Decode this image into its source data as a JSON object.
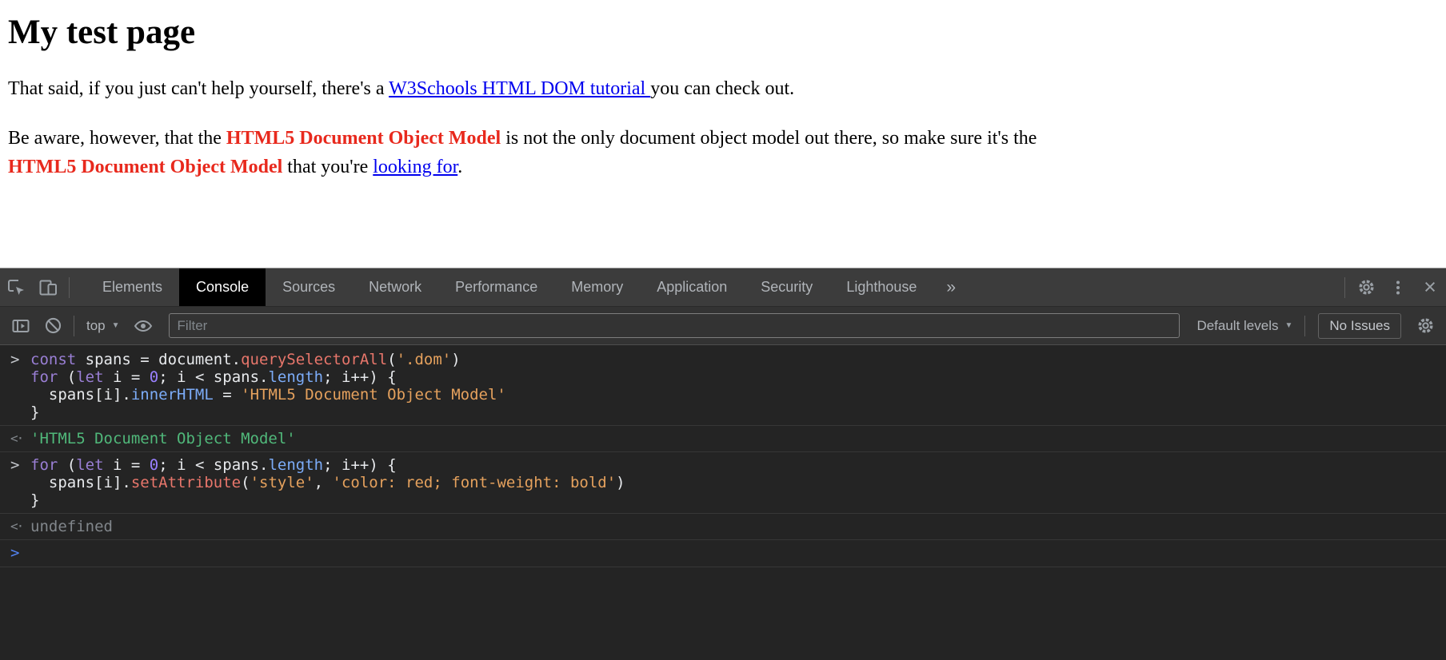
{
  "page": {
    "title": "My test page",
    "para1": {
      "text_before": "That said, if you just can't help yourself, there's a ",
      "link_text": "W3Schools HTML DOM tutorial ",
      "text_after": "you can check out."
    },
    "para2": {
      "text1": "Be aware, however, that the ",
      "highlight1": "HTML5 Document Object Model",
      "text2": " is not the only document object model out there, so make sure it's the",
      "highlight2": "HTML5 Document Object Model",
      "text3": " that you're ",
      "link_text": "looking for",
      "text4": "."
    }
  },
  "colors": {
    "link_blue": "#0000ee",
    "highlight_red": "#e8291d",
    "console_background": "#242424",
    "toolbar_background": "#333333",
    "tabbar_background": "#3c3c3c",
    "active_tab_background": "#000000",
    "result_string_green": "#50b87a",
    "string_orange": "#e5a15d",
    "keyword_purple": "#9a7fd5",
    "function_salmon": "#e8766b",
    "property_blue": "#7cacf8",
    "prompt_blue": "#5282f0"
  },
  "devtools": {
    "tab_bar": {
      "tabs": [
        {
          "label": "Elements",
          "active": false
        },
        {
          "label": "Console",
          "active": true
        },
        {
          "label": "Sources",
          "active": false
        },
        {
          "label": "Network",
          "active": false
        },
        {
          "label": "Performance",
          "active": false
        },
        {
          "label": "Memory",
          "active": false
        },
        {
          "label": "Application",
          "active": false
        },
        {
          "label": "Security",
          "active": false
        },
        {
          "label": "Lighthouse",
          "active": false
        }
      ],
      "more_tabs": "»"
    },
    "toolbar": {
      "context_selector": "top",
      "filter_placeholder": "Filter",
      "levels_label": "Default levels",
      "issues_label": "No Issues"
    },
    "console": {
      "entries": [
        {
          "type": "input",
          "lines": [
            [
              {
                "t": "const",
                "c": "kw"
              },
              {
                "t": " spans = document.",
                "c": "pl"
              },
              {
                "t": "querySelectorAll",
                "c": "fn"
              },
              {
                "t": "(",
                "c": "pl"
              },
              {
                "t": "'.dom'",
                "c": "str"
              },
              {
                "t": ")",
                "c": "pl"
              }
            ],
            [
              {
                "t": "for",
                "c": "kw"
              },
              {
                "t": " (",
                "c": "pl"
              },
              {
                "t": "let",
                "c": "kw"
              },
              {
                "t": " i = ",
                "c": "pl"
              },
              {
                "t": "0",
                "c": "num"
              },
              {
                "t": "; i < spans.",
                "c": "pl"
              },
              {
                "t": "length",
                "c": "prop"
              },
              {
                "t": "; i++) {",
                "c": "pl"
              }
            ],
            [
              {
                "t": "  spans[i].",
                "c": "pl"
              },
              {
                "t": "innerHTML",
                "c": "prop"
              },
              {
                "t": " = ",
                "c": "pl"
              },
              {
                "t": "'HTML5 Document Object Model'",
                "c": "str"
              }
            ],
            [
              {
                "t": "}",
                "c": "pl"
              }
            ]
          ]
        },
        {
          "type": "result",
          "lines": [
            [
              {
                "t": "'HTML5 Document Object Model'",
                "c": "res-str"
              }
            ]
          ]
        },
        {
          "type": "input",
          "lines": [
            [
              {
                "t": "for",
                "c": "kw"
              },
              {
                "t": " (",
                "c": "pl"
              },
              {
                "t": "let",
                "c": "kw"
              },
              {
                "t": " i = ",
                "c": "pl"
              },
              {
                "t": "0",
                "c": "num"
              },
              {
                "t": "; i < spans.",
                "c": "pl"
              },
              {
                "t": "length",
                "c": "prop"
              },
              {
                "t": "; i++) {",
                "c": "pl"
              }
            ],
            [
              {
                "t": "  spans[i].",
                "c": "pl"
              },
              {
                "t": "setAttribute",
                "c": "fn"
              },
              {
                "t": "(",
                "c": "pl"
              },
              {
                "t": "'style'",
                "c": "str"
              },
              {
                "t": ", ",
                "c": "pl"
              },
              {
                "t": "'color: red; font-weight: bold'",
                "c": "str"
              },
              {
                "t": ")",
                "c": "pl"
              }
            ],
            [
              {
                "t": "}",
                "c": "pl"
              }
            ]
          ]
        },
        {
          "type": "result",
          "lines": [
            [
              {
                "t": "undefined",
                "c": "undef"
              }
            ]
          ]
        },
        {
          "type": "prompt",
          "lines": []
        }
      ]
    }
  }
}
